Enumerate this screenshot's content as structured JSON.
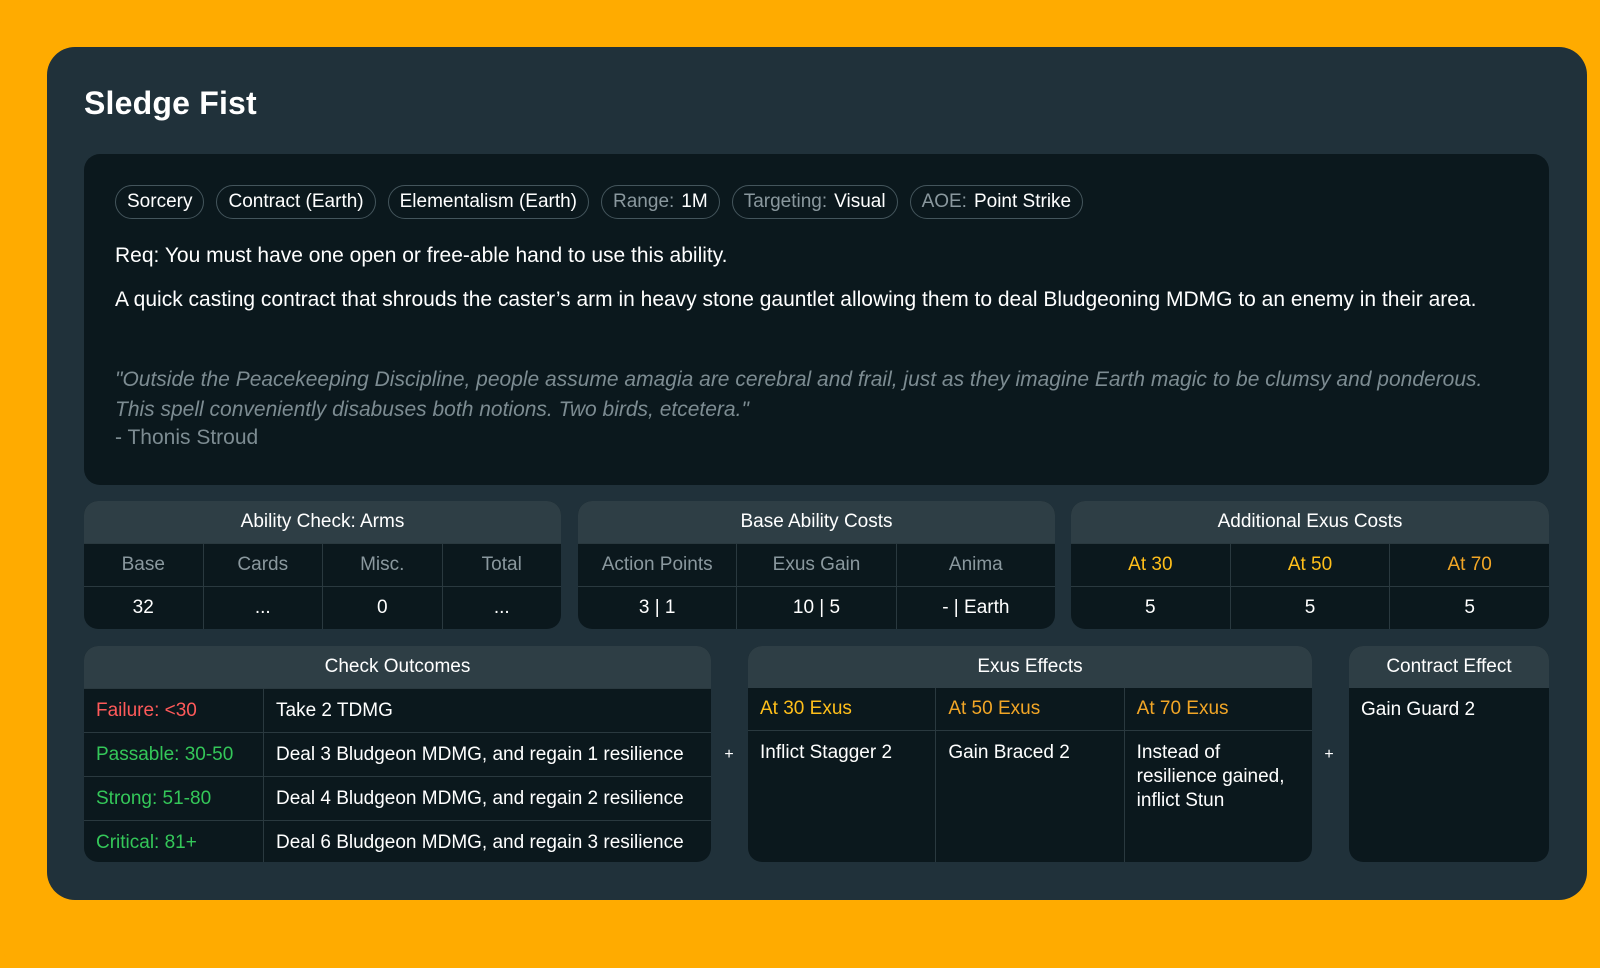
{
  "title": "Sledge Fist",
  "tags": [
    {
      "key": "",
      "value": "Sorcery"
    },
    {
      "key": "",
      "value": "Contract (Earth)"
    },
    {
      "key": "",
      "value": "Elementalism (Earth)"
    },
    {
      "key": "Range:",
      "value": "1M"
    },
    {
      "key": "Targeting:",
      "value": "Visual"
    },
    {
      "key": "AOE:",
      "value": "Point Strike"
    }
  ],
  "requirement": "Req: You must have one open or free-able hand to use this ability.",
  "description": "A quick casting contract that shrouds the caster’s arm in heavy stone gauntlet allowing them to deal Bludgeoning MDMG to an enemy in their area.",
  "quote": "\"Outside the Peacekeeping Discipline, people assume amagia are cerebral and frail, just as they imagine Earth magic to be clumsy and ponderous. This spell conveniently disabuses both notions. Two birds, etcetera.\"",
  "attribution": "- Thonis Stroud",
  "ability_check": {
    "title": "Ability Check: Arms",
    "headers": [
      "Base",
      "Cards",
      "Misc.",
      "Total"
    ],
    "values": [
      "32",
      "...",
      "0",
      "..."
    ]
  },
  "base_costs": {
    "title": "Base Ability Costs",
    "headers": [
      "Action Points",
      "Exus Gain",
      "Anima"
    ],
    "values": [
      "3 | 1",
      "10 | 5",
      "- | Earth"
    ]
  },
  "additional_costs": {
    "title": "Additional Exus Costs",
    "headers": [
      "At 30",
      "At 50",
      "At 70"
    ],
    "values": [
      "5",
      "5",
      "5"
    ]
  },
  "check_outcomes": {
    "title": "Check Outcomes",
    "rows": [
      {
        "label": "Failure: <30",
        "text": "Take 2 TDMG"
      },
      {
        "label": "Passable: 30-50",
        "text": "Deal 3 Bludgeon MDMG, and regain 1 resilience"
      },
      {
        "label": "Strong: 51-80",
        "text": "Deal 4 Bludgeon MDMG, and regain 2 resilience"
      },
      {
        "label": "Critical: 81+",
        "text": "Deal 6 Bludgeon MDMG, and regain 3 resilience"
      }
    ]
  },
  "exus_effects": {
    "title": "Exus Effects",
    "columns": [
      {
        "header": "At 30 Exus",
        "text": "Inflict Stagger 2"
      },
      {
        "header": "At 50 Exus",
        "text": "Gain Braced 2"
      },
      {
        "header": "At 70 Exus",
        "text": "Instead of resilience gained, inflict Stun"
      }
    ]
  },
  "contract_effect": {
    "title": "Contract Effect",
    "text": "Gain Guard 2"
  },
  "plus_sign": "+",
  "colors": {
    "background": "#ffab00",
    "card": "#20313a",
    "panel": "#0b181d",
    "header": "#2e3e45",
    "gold": "#ffbf1a",
    "failure": "#ff5a5a",
    "success": "#34c759"
  }
}
